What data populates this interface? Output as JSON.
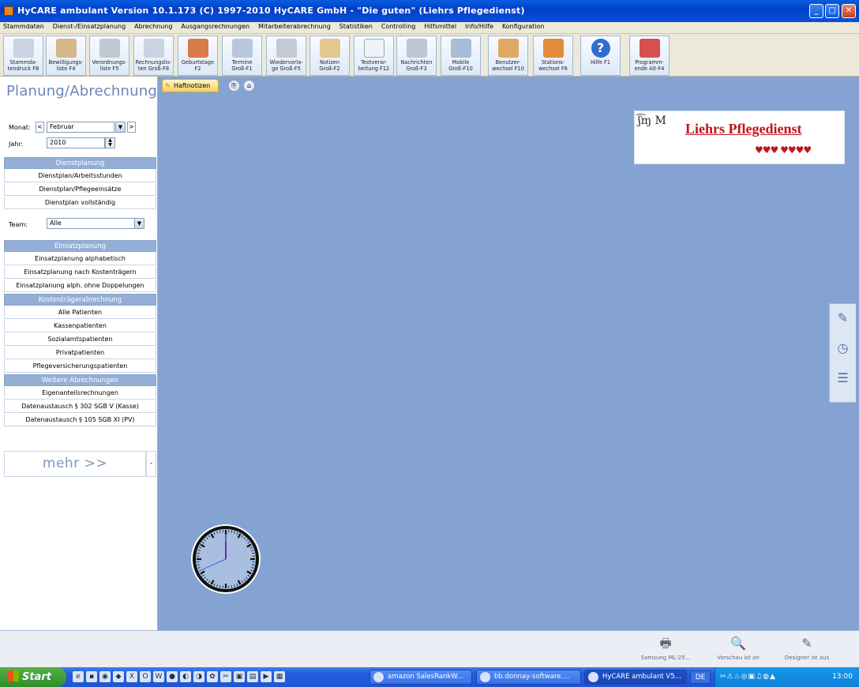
{
  "window": {
    "title": "HyCARE ambulant Version 10.1.173 (C) 1997-2010 HyCARE GmbH - \"Die guten\" (Liehrs Pflegedienst)"
  },
  "menu": [
    "Stammdaten",
    "Dienst-/Einsatzplanung",
    "Abrechnung",
    "Ausgangsrechnungen",
    "Mitarbeiterabrechnung",
    "Statistiken",
    "Controlling",
    "Hilfsmittel",
    "Info/Hilfe",
    "Konfiguration"
  ],
  "toolbar": [
    {
      "label": "Stammda-\ntendruck F8",
      "icon": "printer-icon"
    },
    {
      "label": "Bewilligungs-\nliste F4",
      "icon": "approval-list-icon"
    },
    {
      "label": "Verordnungs-\nliste F5",
      "icon": "prescription-list-icon"
    },
    {
      "label": "Rechnungslis-\nten Groß-F8",
      "icon": "invoice-print-icon"
    },
    {
      "label": "Geburtstage\nF2",
      "icon": "gift-icon"
    },
    {
      "label": "Termine\nGroß-F1",
      "icon": "calendar-icon"
    },
    {
      "label": "Wiedervorla-\nge Groß-F5",
      "icon": "resubmission-icon"
    },
    {
      "label": "Notizen\nGroß-F2",
      "icon": "notes-icon"
    },
    {
      "label": "Textverar-\nbeitung F12",
      "icon": "text-editor-icon"
    },
    {
      "label": "Nachrichten\nGroß-F3",
      "icon": "messages-icon"
    },
    {
      "label": "Mobile\nGroß-F10",
      "icon": "mobile-icon"
    },
    {
      "label": "Benutzer-\nwechsel F10",
      "icon": "user-switch-icon"
    },
    {
      "label": "Stations-\nwechsel F6",
      "icon": "station-switch-icon"
    },
    {
      "label": "Hilfe F1",
      "icon": "help-icon"
    },
    {
      "label": "Programm-\nende Alt-F4",
      "icon": "exit-icon"
    }
  ],
  "left": {
    "title": "Planung/Abrechnung",
    "monat_label": "Monat:",
    "monat_prev": "<",
    "monat_value": "Februar",
    "monat_next": ">",
    "jahr_label": "Jahr:",
    "jahr_value": "2010",
    "team_label": "Team:",
    "team_value": "Alle",
    "sections": [
      {
        "title": "Dienstplanung",
        "items": [
          "Dienstplan/Arbeitsstunden",
          "Dienstplan/Pflegeeinsätze",
          "Dienstplan vollständig"
        ]
      },
      {
        "title": "Einsatzplanung",
        "items": [
          "Einsatzplanung alphabetisch",
          "Einsatzplanung nach Kostenträgern",
          "Einsatzplanung alph. ohne Doppelungen"
        ]
      },
      {
        "title": "Kostenträgerabrechnung",
        "items": [
          "Alle Patienten",
          "Kassenpatienten",
          "Sozialamtspatienten",
          "Privatpatienten",
          "Pflegeversicherungspatienten"
        ]
      },
      {
        "title": "Weitere Abrechnungen",
        "items": [
          "Eigenanteilsrechnungen",
          "Datenaustausch § 302 SGB V (Kasse)",
          "Datenaustausch § 105 SGB XI (PV)"
        ]
      }
    ],
    "mehr": "mehr >>",
    "mehr_side": "-"
  },
  "main": {
    "tab_label": "Haftnotizen",
    "logo_name": "Liehrs Pflegedienst",
    "logo_sig": "ʃ͡ɱ M"
  },
  "bottom": [
    {
      "label": "Samsung ML-25...",
      "icon": "printer-icon"
    },
    {
      "label": "Vorschau ist an",
      "icon": "preview-icon"
    },
    {
      "label": "Designer ist aus",
      "icon": "designer-icon"
    }
  ],
  "taskbar": {
    "start": "Start",
    "tasks": [
      "amazon SalesRankW...",
      "bb.donnay-software....",
      "HyCARE ambulant V5..."
    ],
    "lang": "DE",
    "time": "13:00"
  },
  "clock": {
    "hour": 12,
    "minute": 0,
    "second": 41
  }
}
